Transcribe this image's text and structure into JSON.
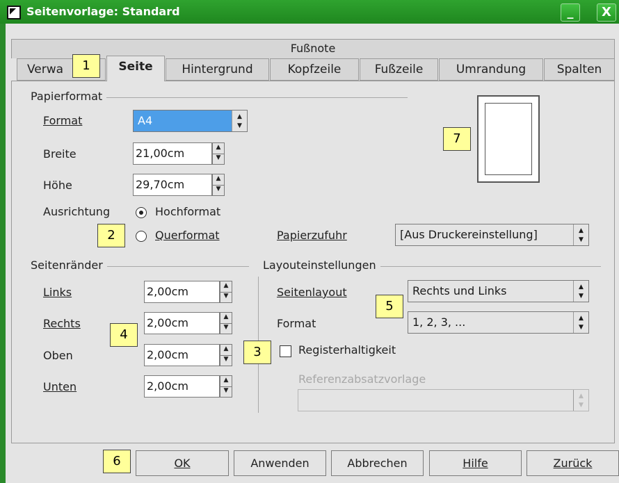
{
  "window": {
    "title": "Seitenvorlage: Standard",
    "minimize_glyph": "_",
    "close_glyph": "X"
  },
  "tabs": {
    "top_row": "Fußnote",
    "row": [
      {
        "label": "Verwa"
      },
      {
        "label": "Seite"
      },
      {
        "label": "Hintergrund"
      },
      {
        "label": "Kopfzeile"
      },
      {
        "label": "Fußzeile"
      },
      {
        "label": "Umrandung"
      },
      {
        "label": "Spalten"
      }
    ],
    "active": "Seite"
  },
  "paper": {
    "group_label": "Papierformat",
    "format_label": "Format",
    "format_value": "A4",
    "width_label": "Breite",
    "width_value": "21,00cm",
    "height_label": "Höhe",
    "height_value": "29,70cm",
    "orientation_label": "Ausrichtung",
    "portrait_label": "Hochformat",
    "landscape_label": "Querformat",
    "paper_source_label": "Papierzufuhr",
    "paper_source_value": "[Aus Druckereinstellung]"
  },
  "margins": {
    "group_label": "Seitenränder",
    "left_label": "Links",
    "left_value": "2,00cm",
    "right_label": "Rechts",
    "right_value": "2,00cm",
    "top_label": "Oben",
    "top_value": "2,00cm",
    "bottom_label": "Unten",
    "bottom_value": "2,00cm"
  },
  "layout": {
    "group_label": "Layouteinstellungen",
    "page_layout_label": "Seitenlayout",
    "page_layout_value": "Rechts und Links",
    "format_label": "Format",
    "format_value": "1, 2, 3, ...",
    "register_label": "Registerhaltigkeit",
    "ref_style_label": "Referenzabsatzvorlage",
    "ref_style_value": ""
  },
  "callouts": [
    "1",
    "2",
    "3",
    "4",
    "5",
    "6",
    "7"
  ],
  "buttons": {
    "ok": "OK",
    "apply": "Anwenden",
    "cancel": "Abbrechen",
    "help": "Hilfe",
    "back": "Zurück"
  },
  "colors": {
    "titlebar": "#2fa32f",
    "selection": "#4d9ee8",
    "callout": "#ffff9a",
    "dialog_bg": "#e4e4e4"
  }
}
